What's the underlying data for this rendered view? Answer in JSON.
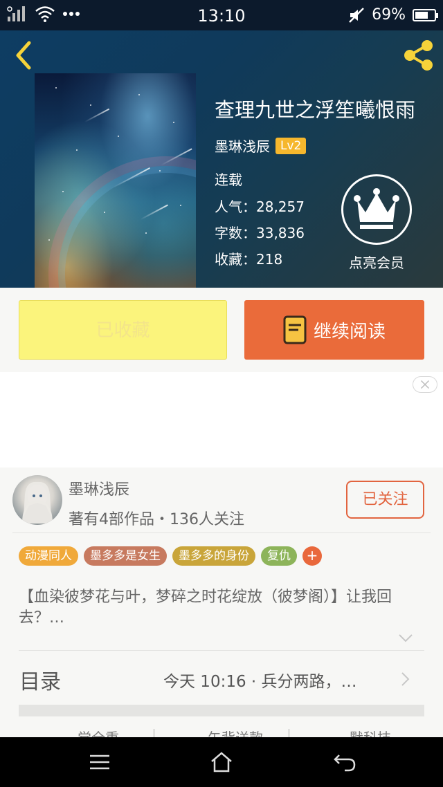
{
  "status_bar": {
    "time": "13:10",
    "battery_percent": "69%",
    "battery_level": 0.69,
    "icons": [
      "signal-icon",
      "wifi-icon",
      "more-dots-icon",
      "mute-icon",
      "battery-icon"
    ]
  },
  "header": {
    "icons": [
      "back-icon",
      "share-icon"
    ],
    "accent_color": "#f6d33a"
  },
  "book": {
    "title": "查理九世之浮笙曦恨雨",
    "author": "墨琳浅辰",
    "level": "Lv2",
    "status": "连载",
    "popularity_label": "人气：",
    "popularity": "28,257",
    "word_count_label": "字数：",
    "word_count": "33,836",
    "favorites_label": "收藏：",
    "favorites": "218",
    "vip_label": "点亮会员"
  },
  "actions": {
    "favorited_label": "已收藏",
    "continue_label": "继续阅读",
    "favorited_color": "#fbf47c",
    "continue_color": "#ea6b3a"
  },
  "author_card": {
    "name": "墨琳浅辰",
    "info": "著有4部作品・136人关注",
    "follow_label": "已关注",
    "tags": [
      {
        "label": "动漫同人",
        "color": "#f0a93a"
      },
      {
        "label": "墨多多是女生",
        "color": "#c77a5f"
      },
      {
        "label": "墨多多的身份",
        "color": "#c9a53a"
      },
      {
        "label": "复仇",
        "color": "#8db45a"
      }
    ],
    "add_tag": "+",
    "description": "【血染彼梦花与叶，梦碎之时花绽放（彼梦阁）】让我回去？…"
  },
  "toc": {
    "label": "目录",
    "latest": "今天 10:16 · 兵分两路，…"
  },
  "bottom_stubs": [
    "觉全重",
    "午背送款",
    "默科技"
  ],
  "nav": {
    "icons": [
      "menu-icon",
      "home-icon",
      "back-arrow-icon"
    ]
  }
}
